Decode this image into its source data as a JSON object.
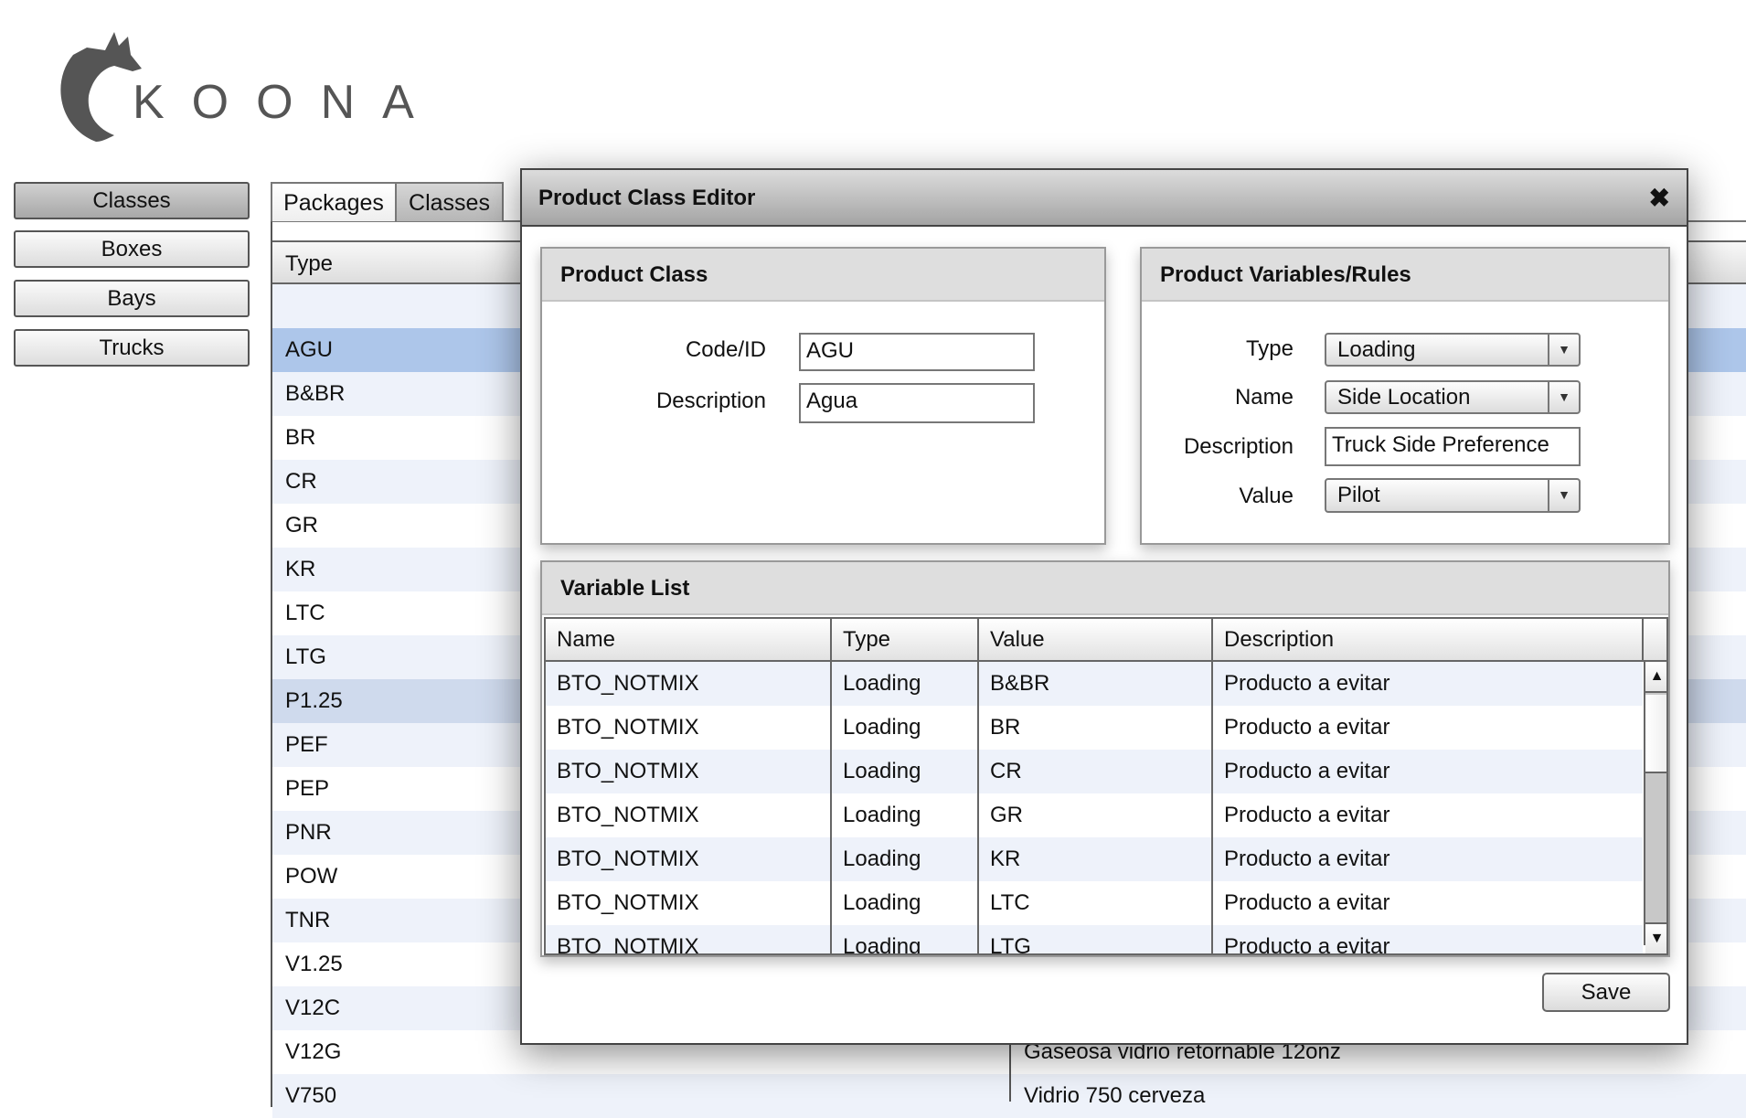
{
  "logo": {
    "text": "KOONA"
  },
  "nav": {
    "items": [
      {
        "label": "Classes"
      },
      {
        "label": "Boxes"
      },
      {
        "label": "Bays"
      },
      {
        "label": "Trucks"
      }
    ]
  },
  "tabs": [
    {
      "label": "Packages"
    },
    {
      "label": "Classes"
    }
  ],
  "list": {
    "header": "Type",
    "rows": [
      {
        "type": "",
        "desc": ""
      },
      {
        "type": "AGU",
        "desc": ""
      },
      {
        "type": "B&BR",
        "desc": ""
      },
      {
        "type": "BR",
        "desc": ""
      },
      {
        "type": "CR",
        "desc": ""
      },
      {
        "type": "GR",
        "desc": ""
      },
      {
        "type": "KR",
        "desc": ""
      },
      {
        "type": "LTC",
        "desc": ""
      },
      {
        "type": "LTG",
        "desc": ""
      },
      {
        "type": "P1.25",
        "desc": ""
      },
      {
        "type": "PEF",
        "desc": ""
      },
      {
        "type": "PEP",
        "desc": ""
      },
      {
        "type": "PNR",
        "desc": ""
      },
      {
        "type": "POW",
        "desc": ""
      },
      {
        "type": "TNR",
        "desc": ""
      },
      {
        "type": "V1.25",
        "desc": ""
      },
      {
        "type": "V12C",
        "desc": ""
      },
      {
        "type": "V12G",
        "desc": "Gaseosa vidrio retornable 12onz"
      },
      {
        "type": "V750",
        "desc": "Vidrio 750 cerveza"
      }
    ],
    "selected": "AGU",
    "hovered": "P1.25"
  },
  "dialog": {
    "title": "Product Class Editor",
    "close_icon": "close-icon",
    "product_class": {
      "heading": "Product Class",
      "code_label": "Code/ID",
      "code_value": "AGU",
      "desc_label": "Description",
      "desc_value": "Agua"
    },
    "rules": {
      "heading": "Product Variables/Rules",
      "type_label": "Type",
      "type_value": "Loading",
      "name_label": "Name",
      "name_value": "Side Location",
      "desc_label": "Description",
      "desc_value": "Truck Side Preference",
      "value_label": "Value",
      "value_value": "Pilot"
    },
    "variables": {
      "heading": "Variable List",
      "columns": [
        "Name",
        "Type",
        "Value",
        "Description"
      ],
      "rows": [
        [
          "BTO_NOTMIX",
          "Loading",
          "B&BR",
          "Producto a evitar"
        ],
        [
          "BTO_NOTMIX",
          "Loading",
          "BR",
          "Producto a evitar"
        ],
        [
          "BTO_NOTMIX",
          "Loading",
          "CR",
          "Producto a evitar"
        ],
        [
          "BTO_NOTMIX",
          "Loading",
          "GR",
          "Producto a evitar"
        ],
        [
          "BTO_NOTMIX",
          "Loading",
          "KR",
          "Producto a evitar"
        ],
        [
          "BTO_NOTMIX",
          "Loading",
          "LTC",
          "Producto a evitar"
        ],
        [
          "BTO_NOTMIX",
          "Loading",
          "LTG",
          "Producto a evitar"
        ]
      ]
    },
    "save_label": "Save"
  },
  "colors": {
    "selected_row": "#adc6ea",
    "stripe": "#eef2fa",
    "hover_row": "#cfdaed"
  }
}
